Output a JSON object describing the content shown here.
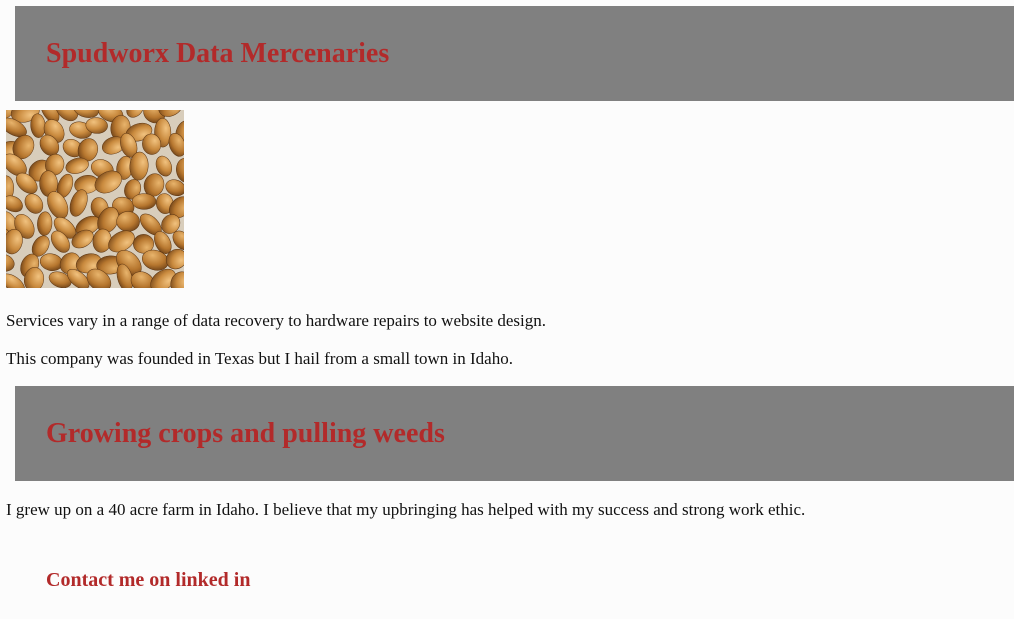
{
  "header": {
    "title": "Spudworx Data Mercenaries"
  },
  "intro": {
    "image_alt": "potatoes",
    "services": "Services vary in a range of data recovery to hardware repairs to website design.",
    "founded": "This company was founded in Texas but I hail from a small town in Idaho."
  },
  "section_farm": {
    "title": "Growing crops and pulling weeds",
    "text": "I grew up on a 40 acre farm in Idaho. I believe that my upbringing has helped with my success and strong work ethic."
  },
  "contact": {
    "label": "Contact me on linked in"
  },
  "colors": {
    "banner_bg": "#808080",
    "heading": "#b22a2a",
    "page_bg": "#fcfcfc"
  }
}
